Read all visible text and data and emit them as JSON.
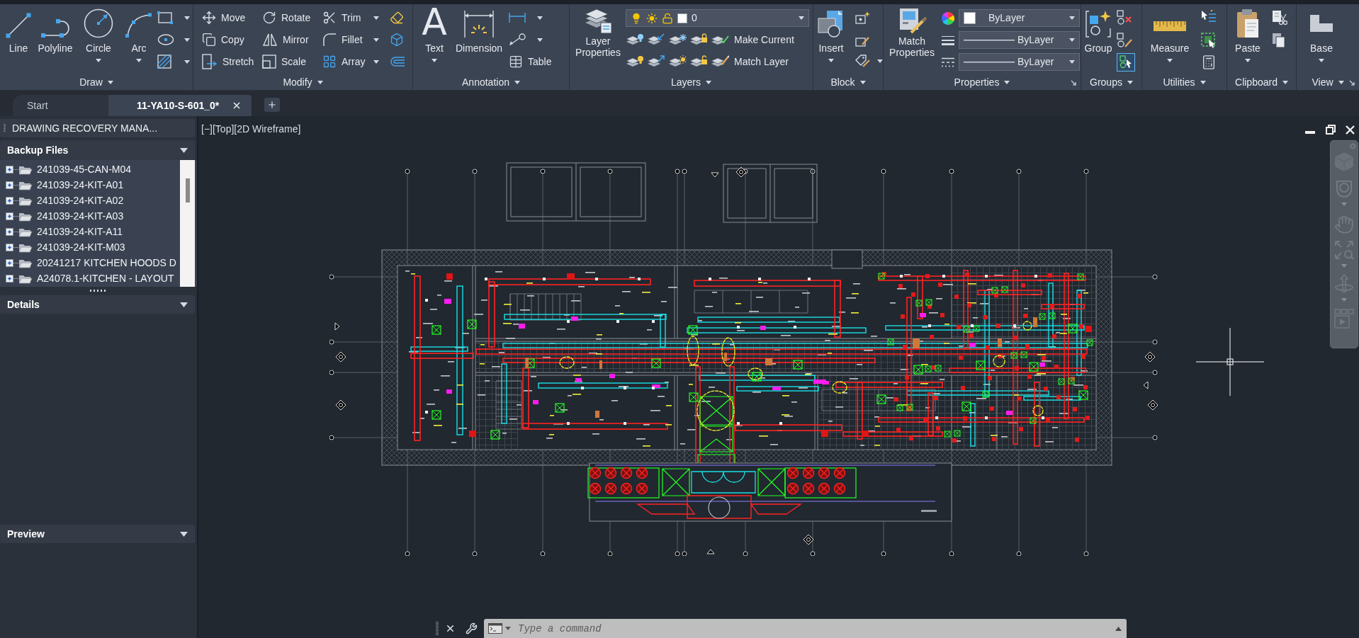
{
  "ribbon": {
    "panels": [
      {
        "title": "Draw",
        "tools": [
          {
            "label": "Line"
          },
          {
            "label": "Polyline"
          },
          {
            "label": "Circle"
          },
          {
            "label": "Arc"
          }
        ]
      },
      {
        "title": "Modify",
        "tools": [
          {
            "label": "Move"
          },
          {
            "label": "Copy"
          },
          {
            "label": "Stretch"
          },
          {
            "label": "Rotate"
          },
          {
            "label": "Mirror"
          },
          {
            "label": "Scale"
          },
          {
            "label": "Trim"
          },
          {
            "label": "Fillet"
          },
          {
            "label": "Array"
          }
        ]
      },
      {
        "title": "Annotation",
        "tools": [
          {
            "label": "Text",
            "glyph": "A"
          },
          {
            "label": "Dimension"
          },
          {
            "label": "Table"
          }
        ]
      },
      {
        "title": "Layers",
        "tools": [
          {
            "label": "Layer Properties"
          },
          {
            "label": "Make Current"
          },
          {
            "label": "Match Layer"
          }
        ],
        "layer": {
          "name": "0",
          "on": true,
          "frozen": false,
          "locked": false
        }
      },
      {
        "title": "Block",
        "tools": [
          {
            "label": "Insert"
          }
        ]
      },
      {
        "title": "Properties",
        "tools": [
          {
            "label": "Match Properties"
          }
        ],
        "dropdowns": [
          {
            "value": "ByLayer"
          },
          {
            "value": "ByLayer"
          },
          {
            "value": "ByLayer"
          }
        ]
      },
      {
        "title": "Groups",
        "tools": [
          {
            "label": "Group"
          }
        ],
        "group_selection": {
          "on": true
        }
      },
      {
        "title": "Utilities",
        "tools": [
          {
            "label": "Measure"
          }
        ]
      },
      {
        "title": "Clipboard",
        "tools": [
          {
            "label": "Paste"
          }
        ]
      },
      {
        "title": "View",
        "tools": [
          {
            "label": "Base"
          }
        ]
      }
    ]
  },
  "file_tabs": [
    {
      "label": "Start",
      "selected": false
    },
    {
      "label": "11-YA10-S-601_0*",
      "selected": true
    }
  ],
  "recovery_manager": {
    "title": "DRAWING RECOVERY MANA...",
    "sections": [
      {
        "title": "Backup Files",
        "expanded": true,
        "files": [
          {
            "label": "241039-45-CAN-M04",
            "expanded": false
          },
          {
            "label": "241039-24-KIT-A01",
            "expanded": false
          },
          {
            "label": "241039-24-KIT-A02",
            "expanded": false
          },
          {
            "label": "241039-24-KIT-A03",
            "expanded": false
          },
          {
            "label": "241039-24-KIT-A11",
            "expanded": false
          },
          {
            "label": "241039-24-KIT-M03",
            "expanded": false
          },
          {
            "label": "20241217 KITCHEN HOODS D",
            "expanded": false
          },
          {
            "label": "A24078.1-KITCHEN - LAYOUT",
            "expanded": false
          }
        ]
      },
      {
        "title": "Details",
        "expanded": true
      },
      {
        "title": "Preview",
        "expanded": true
      }
    ]
  },
  "viewport": {
    "controls": [
      {
        "label": "[−]"
      },
      {
        "label": "[Top]"
      },
      {
        "label": "[2D Wireframe]"
      }
    ]
  },
  "command_line": {
    "placeholder": "Type a command"
  }
}
